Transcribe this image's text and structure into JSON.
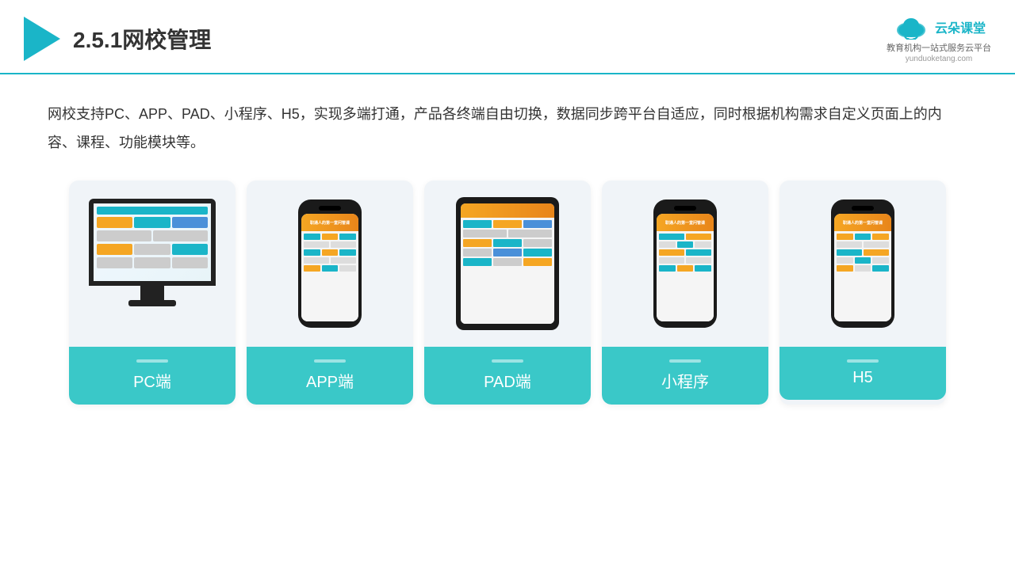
{
  "header": {
    "title": "2.5.1网校管理",
    "logo_text": "云朵课堂",
    "logo_subtitle": "教育机构一站\n式服务云平台",
    "logo_url": "yunduoketang.com"
  },
  "description": {
    "text": "网校支持PC、APP、PAD、小程序、H5，实现多端打通，产品各终端自由切换，数据同步跨平台自适应，同时根据机构需求自定义页面上的内容、课程、功能模块等。"
  },
  "cards": [
    {
      "id": "pc",
      "label": "PC端"
    },
    {
      "id": "app",
      "label": "APP端"
    },
    {
      "id": "pad",
      "label": "PAD端"
    },
    {
      "id": "mini",
      "label": "小程序"
    },
    {
      "id": "h5",
      "label": "H5"
    }
  ],
  "colors": {
    "accent": "#1ab5c8",
    "card_bg": "#eef2f7",
    "card_label_bg": "#3ac8c8"
  }
}
